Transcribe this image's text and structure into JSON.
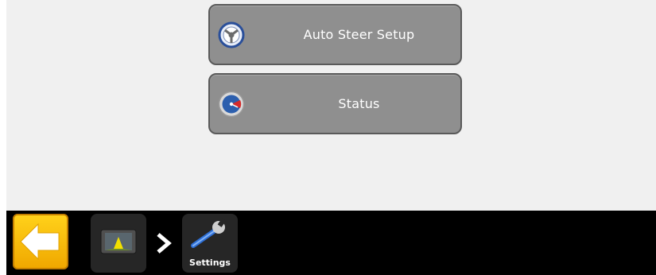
{
  "menu": {
    "auto_steer_label": "Auto Steer Setup",
    "status_label": "Status"
  },
  "taskbar": {
    "settings_label": "Settings"
  },
  "colors": {
    "screen_bg": "#f0f0f0",
    "button_bg": "#8f8f8f",
    "taskbar_bg": "#000000",
    "back_accent": "#f5b800"
  },
  "icons": {
    "auto_steer": "steering-wheel-icon",
    "status": "gauge-icon",
    "back": "arrow-left-icon",
    "home": "display-terminal-icon",
    "breadcrumb_separator": "chevron-right-icon",
    "settings": "wrench-icon"
  }
}
